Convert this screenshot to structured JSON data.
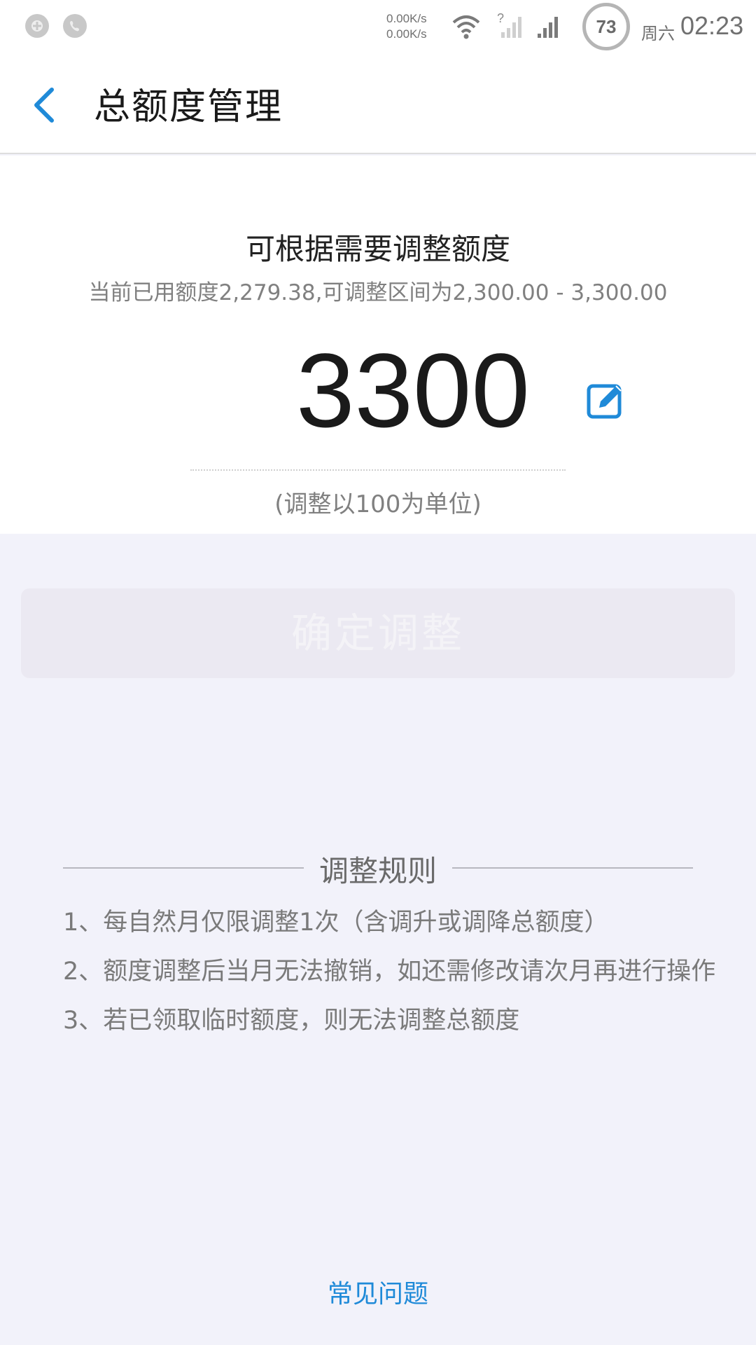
{
  "status_bar": {
    "net_speed_up": "0.00K/s",
    "net_speed_down": "0.00K/s",
    "battery": "73",
    "day": "周六",
    "time": "02:23"
  },
  "header": {
    "title": "总额度管理",
    "accent_color": "#1f8ad8"
  },
  "card": {
    "heading": "可根据需要调整额度",
    "subtitle": "当前已用额度2,279.38,可调整区间为2,300.00 - 3,300.00",
    "amount": "3300",
    "unit_hint": "(调整以100为单位)"
  },
  "confirm_button": {
    "label": "确定调整"
  },
  "rules": {
    "title": "调整规则",
    "items": [
      "1、每自然月仅限调整1次（含调升或调降总额度）",
      "2、额度调整后当月无法撤销，如还需修改请次月再进行操作",
      "3、若已领取临时额度，则无法调整总额度"
    ]
  },
  "faq": {
    "label": "常见问题"
  }
}
